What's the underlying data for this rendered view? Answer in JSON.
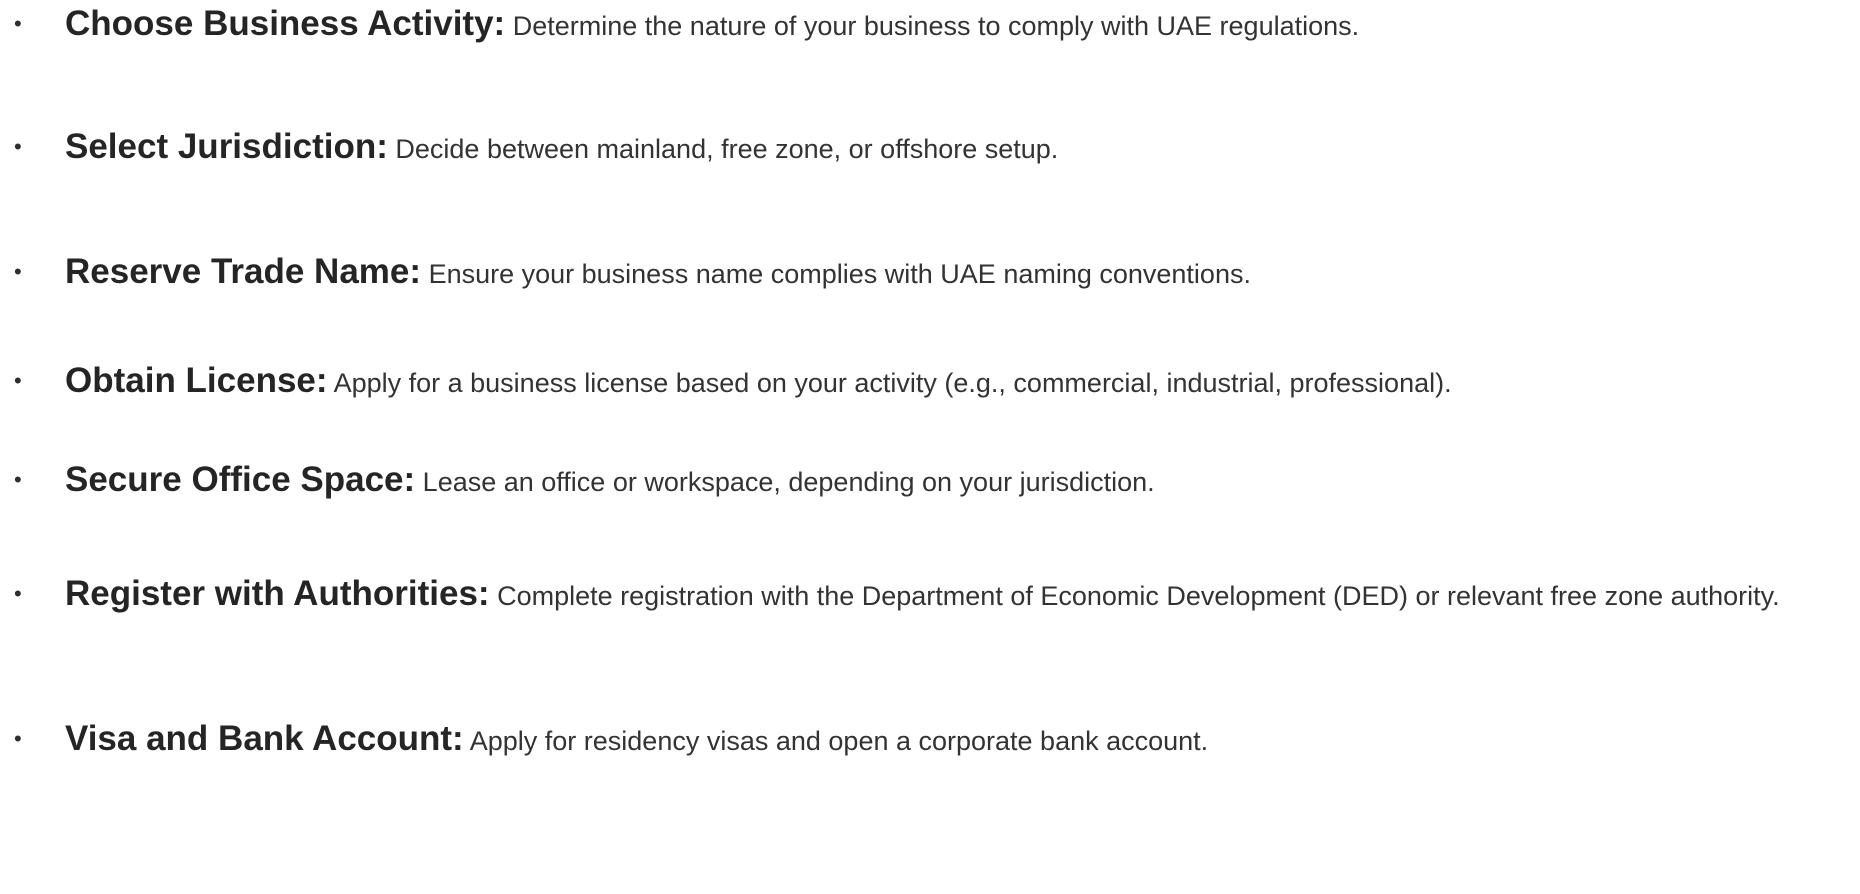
{
  "steps": [
    {
      "bullet": "•",
      "term": "Choose Business Activity:",
      "description": "Determine the nature of your business to comply with UAE regulations."
    },
    {
      "bullet": "•",
      "term": "Select Jurisdiction:",
      "description": "Decide between mainland, free zone, or offshore setup."
    },
    {
      "bullet": "•",
      "term": "Reserve Trade Name:",
      "description": "Ensure your business name complies with UAE naming conventions."
    },
    {
      "bullet": "•",
      "term": "Obtain License:",
      "description": "Apply for a business license based on your activity (e.g., commercial, industrial, professional)."
    },
    {
      "bullet": "•",
      "term": "Secure Office Space:",
      "description": "Lease an office or workspace, depending on your jurisdiction."
    },
    {
      "bullet": "•",
      "term": "Register with Authorities:",
      "description": "Complete registration with the Department of Economic Development (DED) or relevant free zone authority."
    },
    {
      "bullet": "•",
      "term": "Visa and Bank Account:",
      "description": "Apply for residency visas and open a corporate bank account."
    }
  ]
}
